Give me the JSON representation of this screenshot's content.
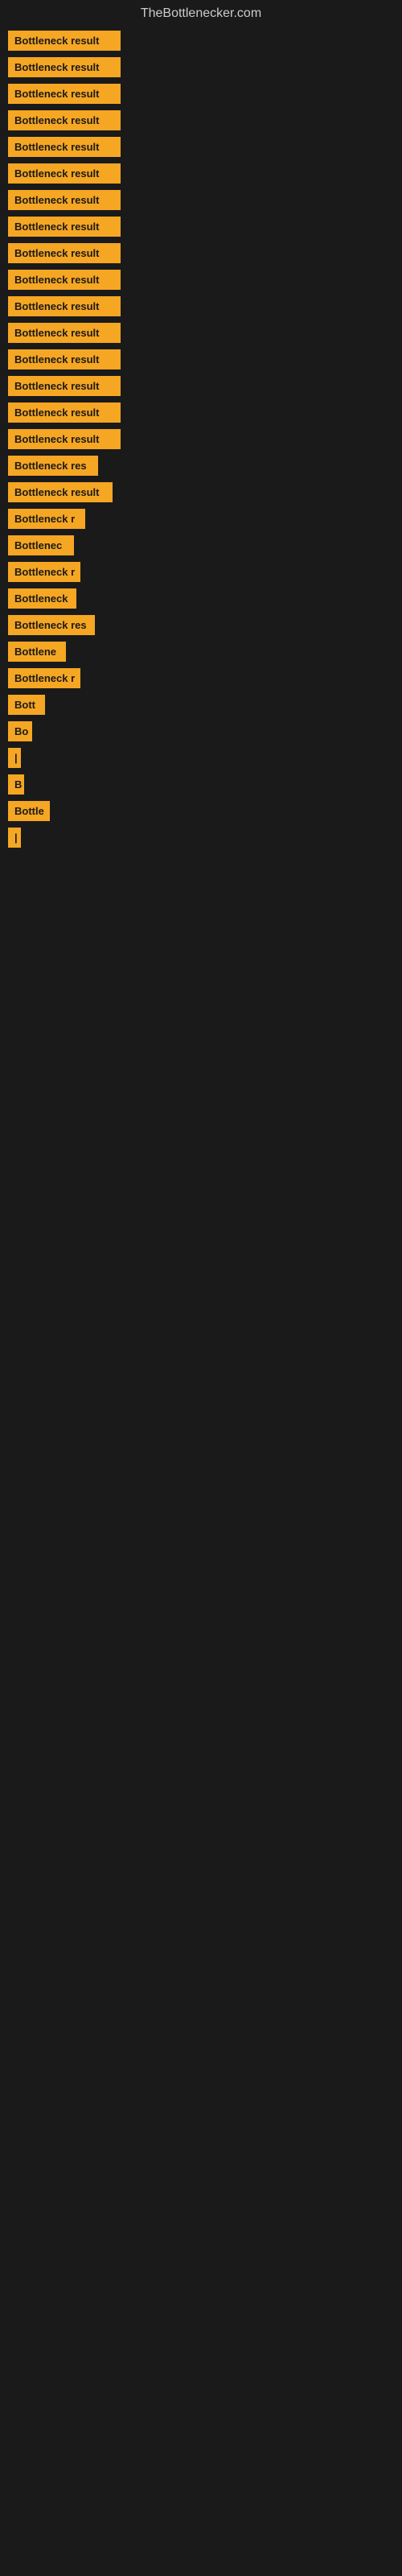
{
  "header": {
    "title": "TheBottlenecker.com"
  },
  "items": [
    {
      "label": "Bottleneck result",
      "width": 140
    },
    {
      "label": "Bottleneck result",
      "width": 140
    },
    {
      "label": "Bottleneck result",
      "width": 140
    },
    {
      "label": "Bottleneck result",
      "width": 140
    },
    {
      "label": "Bottleneck result",
      "width": 140
    },
    {
      "label": "Bottleneck result",
      "width": 140
    },
    {
      "label": "Bottleneck result",
      "width": 140
    },
    {
      "label": "Bottleneck result",
      "width": 140
    },
    {
      "label": "Bottleneck result",
      "width": 140
    },
    {
      "label": "Bottleneck result",
      "width": 140
    },
    {
      "label": "Bottleneck result",
      "width": 140
    },
    {
      "label": "Bottleneck result",
      "width": 140
    },
    {
      "label": "Bottleneck result",
      "width": 140
    },
    {
      "label": "Bottleneck result",
      "width": 140
    },
    {
      "label": "Bottleneck result",
      "width": 140
    },
    {
      "label": "Bottleneck result",
      "width": 140
    },
    {
      "label": "Bottleneck res",
      "width": 112
    },
    {
      "label": "Bottleneck result",
      "width": 130
    },
    {
      "label": "Bottleneck r",
      "width": 96
    },
    {
      "label": "Bottlenec",
      "width": 82
    },
    {
      "label": "Bottleneck r",
      "width": 90
    },
    {
      "label": "Bottleneck",
      "width": 85
    },
    {
      "label": "Bottleneck res",
      "width": 108
    },
    {
      "label": "Bottlene",
      "width": 72
    },
    {
      "label": "Bottleneck r",
      "width": 90
    },
    {
      "label": "Bott",
      "width": 46
    },
    {
      "label": "Bo",
      "width": 30
    },
    {
      "label": "|",
      "width": 10
    },
    {
      "label": "B",
      "width": 20
    },
    {
      "label": "Bottle",
      "width": 52
    },
    {
      "label": "|",
      "width": 8
    }
  ]
}
